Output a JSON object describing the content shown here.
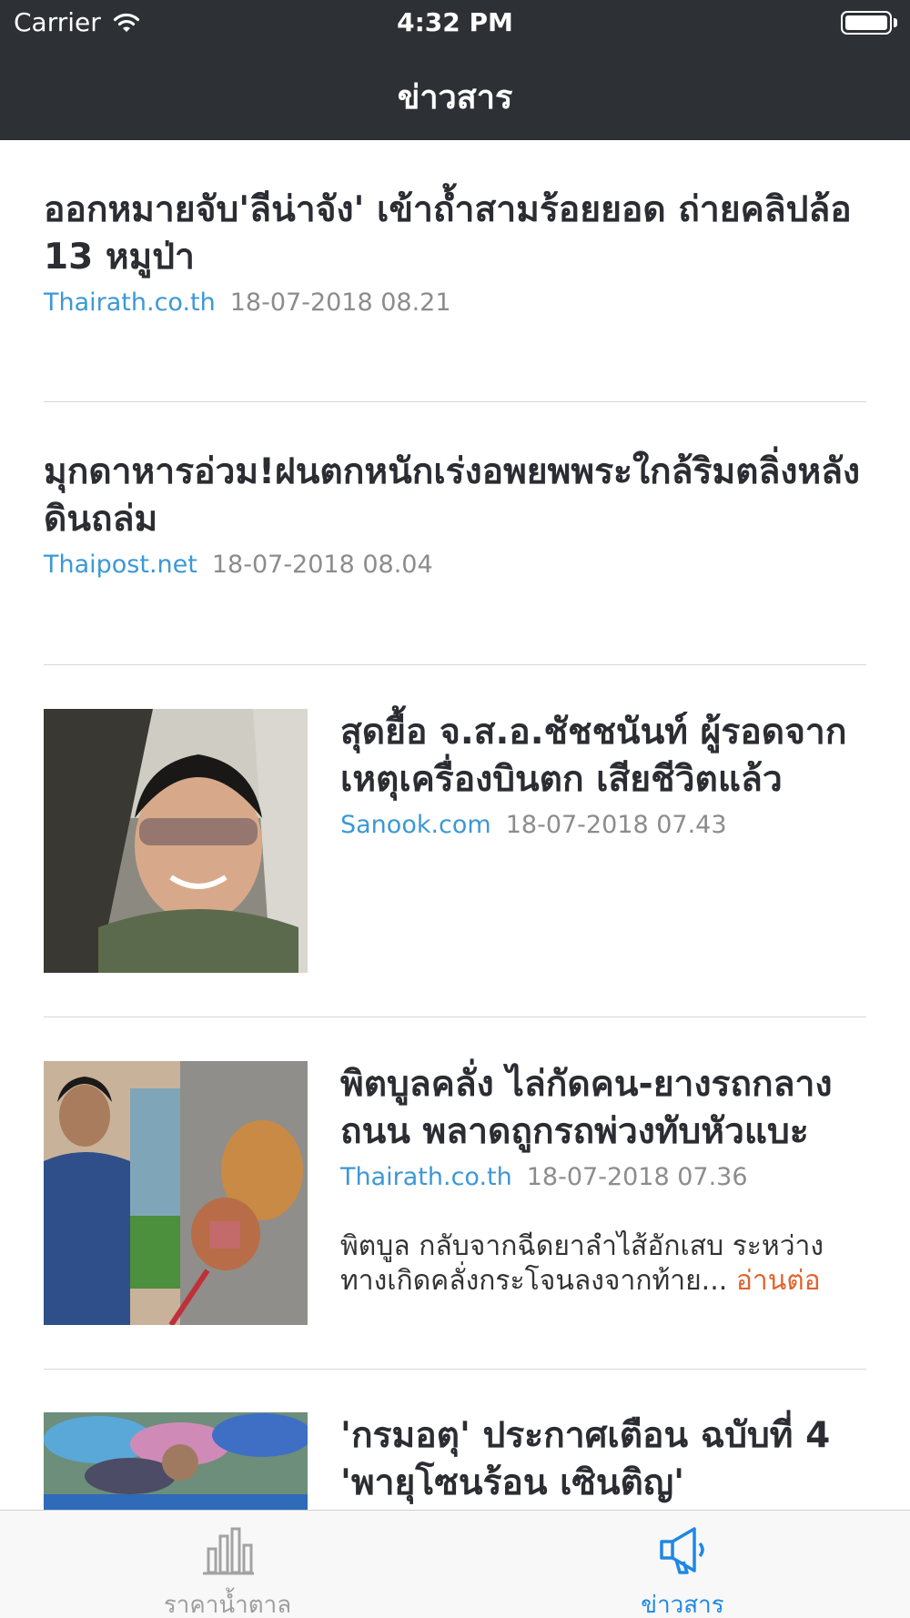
{
  "status_bar": {
    "carrier": "Carrier",
    "time": "4:32 PM"
  },
  "nav": {
    "title": "ข่าวสาร"
  },
  "news": [
    {
      "title": "ออกหมายจับ'ลีน่าจัง' เข้าถ้ำสามร้อยยอด ถ่ายคลิปล้อ 13 หมูป่า",
      "source": "Thairath.co.th",
      "date": "18-07-2018 08.21"
    },
    {
      "title": "มุกดาหารอ่วม!ฝนตกหนักเร่งอพยพพระใกล้ริมตลิ่งหลังดินถล่ม",
      "source": "Thaipost.net",
      "date": "18-07-2018 08.04"
    },
    {
      "title": "สุดยื้อ จ.ส.อ.ชัชชนันท์ ผู้รอดจากเหตุเครื่องบินตก เสียชีวิตแล้ว",
      "source": "Sanook.com",
      "date": "18-07-2018 07.43"
    },
    {
      "title": "พิตบูลคลั่ง ไล่กัดคน-ยางรถกลางถนน พลาดถูกรถพ่วงทับหัวแบะ",
      "source": "Thairath.co.th",
      "date": "18-07-2018 07.36",
      "summary": "พิตบูล กลับจากฉีดยาลำไส้อักเสบ ระหว่างทางเกิดคลั่งกระโจนลงจากท้าย...",
      "more": " อ่านต่อ"
    },
    {
      "title": "'กรมอตุ' ประกาศเตือน ฉบับที่ 4 'พายุโซนร้อน เซินติญ'"
    }
  ],
  "tabbar": {
    "tabs": [
      {
        "label": "ราคาน้ำตาล",
        "icon": "bar-chart-icon",
        "active": false
      },
      {
        "label": "ข่าวสาร",
        "icon": "megaphone-icon",
        "active": true
      }
    ]
  },
  "colors": {
    "nav_bg": "#2d3035",
    "source": "#3c98d6",
    "read_more": "#e0642c",
    "tab_active": "#1e88e5",
    "tab_inactive": "#9e9e9e"
  }
}
